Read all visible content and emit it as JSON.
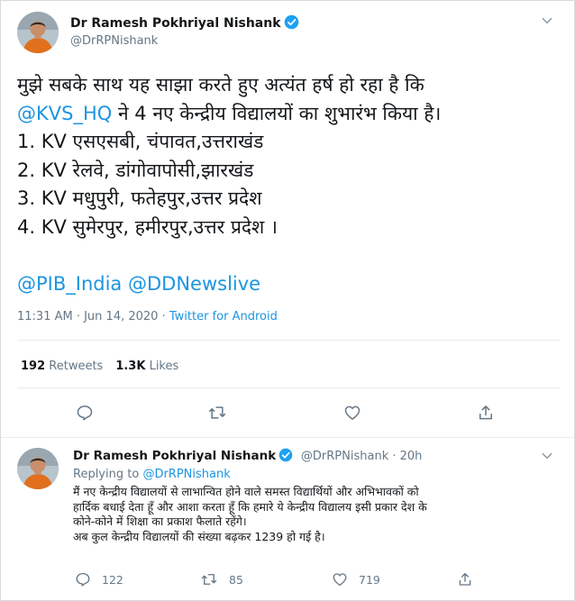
{
  "tweet": {
    "author_name": "Dr Ramesh Pokhriyal Nishank",
    "author_handle": "@DrRPNishank",
    "lines": {
      "l1": "मुझे सबके साथ यह साझा करते हुए अत्यंत हर्ष हो रहा है कि",
      "l2_mention": "@KVS_HQ",
      "l2_rest": " ने 4 नए केन्द्रीय विद्यालयों का शुभारंभ किया है।",
      "l3": "1. KV एसएसबी, चंपावत,उत्तराखंड",
      "l4": "2. KV रेलवे, डांगोवापोसी,झारखंड",
      "l5": "3. KV मधुपुरी, फतेहपुर,उत्तर प्रदेश",
      "l6": "4. KV सुमेरपुर, हमीरपुर,उत्तर प्रदेश ।",
      "mention_pib": "@PIB_India",
      "mention_dd": "@DDNewslive"
    },
    "time": "11:31 AM · Jun 14, 2020",
    "source_sep": " · ",
    "source": "Twitter for Android",
    "retweets_count": "192",
    "retweets_label": "Retweets",
    "likes_count": "1.3K",
    "likes_label": "Likes"
  },
  "reply": {
    "author_name": "Dr Ramesh Pokhriyal Nishank",
    "author_handle": "@DrRPNishank",
    "time_sep": "·",
    "time": "20h",
    "replying_label": "Replying to",
    "replying_handle": "@DrRPNishank",
    "lines": [
      "मैं नए केन्द्रीय विद्यालयों से लाभान्वित होने वाले समस्त विद्यार्थियों और अभिभावकों को",
      "हार्दिक बधाई देता हूँ और आशा करता हूँ कि हमारे ये केन्द्रीय विद्यालय इसी प्रकार देश के",
      "कोने-कोने में शिक्षा का प्रकाश फैलाते रहेंगे।",
      "अब कुल केन्द्रीय विद्यालयों की संख्या बढ़कर 1239 हो गई है।"
    ],
    "reply_count": "122",
    "retweet_count": "85",
    "like_count": "719"
  },
  "icons": {
    "verified": "verified-badge-icon",
    "chevron": "chevron-down-icon",
    "reply": "reply-icon",
    "retweet": "retweet-icon",
    "like": "heart-icon",
    "share": "share-icon"
  },
  "colors": {
    "link": "#1b95e0",
    "muted": "#657786",
    "text": "#14171a",
    "verified": "#1da1f2"
  }
}
